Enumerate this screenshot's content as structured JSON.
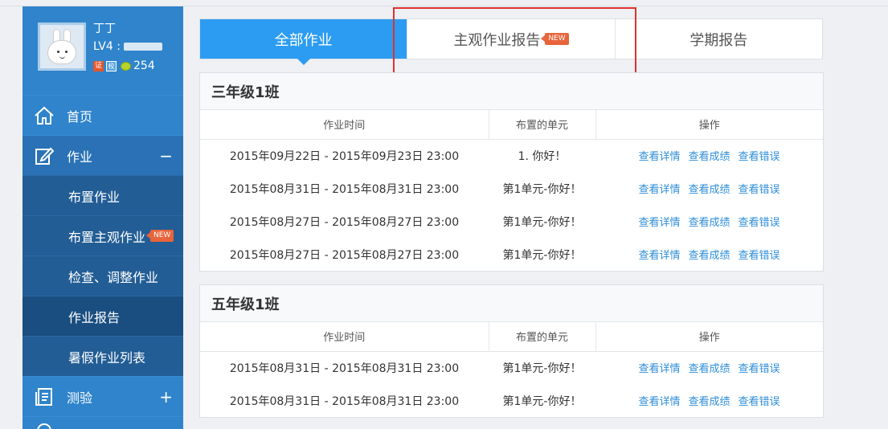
{
  "sidebar": {
    "profile": {
      "username": "丁丁",
      "level_label": "LV4 :",
      "badge_cert": "证",
      "badge_school": "校",
      "beans": "254"
    },
    "items": [
      {
        "label": "首页"
      },
      {
        "label": "作业",
        "toggle": "−"
      },
      {
        "label": "布置作业"
      },
      {
        "label": "布置主观作业",
        "tag": "NEW"
      },
      {
        "label": "检查、调整作业"
      },
      {
        "label": "作业报告"
      },
      {
        "label": "暑假作业列表"
      },
      {
        "label": "测验",
        "toggle": "+"
      }
    ]
  },
  "tabs": [
    {
      "label": "全部作业",
      "active": true
    },
    {
      "label": "主观作业报告",
      "tag": "NEW"
    },
    {
      "label": "学期报告"
    }
  ],
  "table_headers": {
    "time": "作业时间",
    "unit": "布置的单元",
    "ops": "操作"
  },
  "ops_labels": {
    "detail": "查看详情",
    "score": "查看成绩",
    "errors": "查看错误"
  },
  "classes": [
    {
      "name": "三年级1班",
      "rows": [
        {
          "time": "2015年09月22日 - 2015年09月23日 23:00",
          "unit": "1. 你好！"
        },
        {
          "time": "2015年08月31日 - 2015年08月31日 23:00",
          "unit": "第1单元-你好！"
        },
        {
          "time": "2015年08月27日 - 2015年08月27日 23:00",
          "unit": "第1单元-你好！"
        },
        {
          "time": "2015年08月27日 - 2015年08月27日 23:00",
          "unit": "第1单元-你好！"
        }
      ]
    },
    {
      "name": "五年级1班",
      "rows": [
        {
          "time": "2015年08月31日 - 2015年08月31日 23:00",
          "unit": "第1单元-你好！"
        },
        {
          "time": "2015年08月31日 - 2015年08月31日 23:00",
          "unit": "第1单元-你好！"
        }
      ]
    }
  ],
  "colors": {
    "accent": "#2b9cf2",
    "sidebar": "#2e80c6",
    "highlight": "#e0302f",
    "link": "#2e8ed8"
  }
}
